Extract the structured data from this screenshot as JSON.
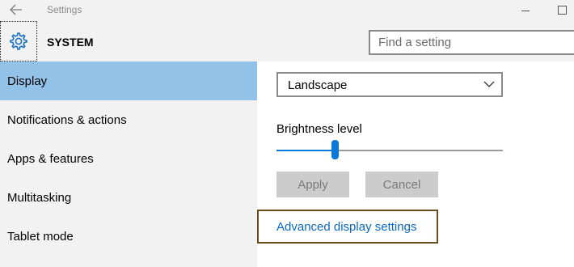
{
  "window": {
    "title": "Settings"
  },
  "header": {
    "title": "SYSTEM",
    "search_placeholder": "Find a setting"
  },
  "sidebar": {
    "items": [
      {
        "label": "Display",
        "selected": true
      },
      {
        "label": "Notifications & actions",
        "selected": false
      },
      {
        "label": "Apps & features",
        "selected": false
      },
      {
        "label": "Multitasking",
        "selected": false
      },
      {
        "label": "Tablet mode",
        "selected": false
      }
    ]
  },
  "display": {
    "orientation_value": "Landscape",
    "brightness_label": "Brightness level",
    "brightness_level": 0.25,
    "apply_label": "Apply",
    "cancel_label": "Cancel",
    "advanced_link": "Advanced display settings"
  },
  "colors": {
    "accent": "#0a78d7",
    "selected_nav": "#93c2e8",
    "link": "#0a68c4",
    "highlight_border": "#6b4c1e"
  }
}
